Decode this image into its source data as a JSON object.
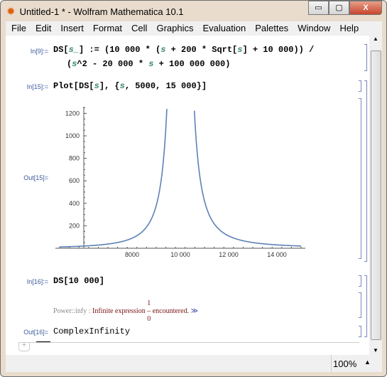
{
  "window": {
    "title": "Untitled-1 * - Wolfram Mathematica 10.1",
    "minimize": "▭",
    "maximize": "▢",
    "close": "X"
  },
  "menu": [
    "File",
    "Edit",
    "Insert",
    "Format",
    "Cell",
    "Graphics",
    "Evaluation",
    "Palettes",
    "Window",
    "Help"
  ],
  "cells": {
    "in9": {
      "label": "In[9]:=",
      "line1a": "DS[",
      "line1var": "s_",
      "line1b": "] := (10 000 * (",
      "s": "s",
      "line1c": " + 200 * Sqrt[",
      "line1d": "] + 10 000)) /",
      "line2a": "(",
      "line2b": "^2 - 20 000 * ",
      "line2c": " + 100 000 000)"
    },
    "in15": {
      "label": "In[15]:=",
      "code_a": "Plot[DS[",
      "s": "s",
      "code_b": "], {",
      "code_c": ", 5000, 15 000}]"
    },
    "out15": {
      "label": "Out[15]="
    },
    "in16": {
      "label": "In[16]:=",
      "code": "DS[10 000]"
    },
    "message": {
      "tag": "Power::infy :",
      "text": "Infinite expression",
      "num": "1",
      "den": "0",
      "text2": "encountered.",
      "link": "≫"
    },
    "out16": {
      "label": "Out[16]=",
      "value": "ComplexInfinity"
    }
  },
  "status": {
    "zoom": "100%"
  },
  "chart_data": {
    "type": "line",
    "function": "10000*(s+200*Sqrt[s]+10000)/(s^2-20000*s+100000000)",
    "xlim": [
      5000,
      15000
    ],
    "ylim": [
      0,
      1260
    ],
    "x_axis_origin": 6000,
    "xticks": [
      "8000",
      "10 000",
      "12 000",
      "14 000"
    ],
    "xtick_values": [
      8000,
      10000,
      12000,
      14000
    ],
    "yticks": [
      "200",
      "400",
      "600",
      "800",
      "1000",
      "1200"
    ],
    "ytick_values": [
      200,
      400,
      600,
      800,
      1000,
      1200
    ],
    "color": "#5e81b5"
  }
}
